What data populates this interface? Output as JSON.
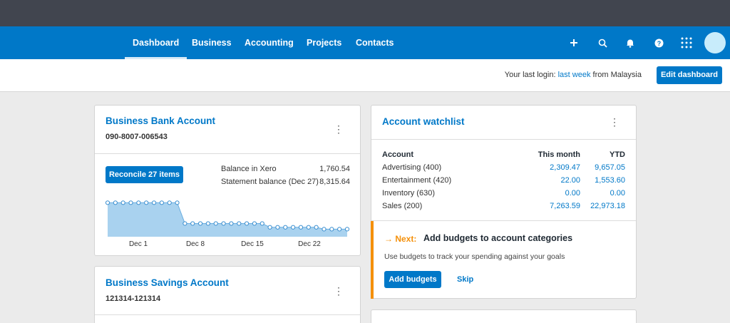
{
  "nav": {
    "items": [
      {
        "label": "Dashboard",
        "active": true
      },
      {
        "label": "Business",
        "active": false
      },
      {
        "label": "Accounting",
        "active": false
      },
      {
        "label": "Projects",
        "active": false
      },
      {
        "label": "Contacts",
        "active": false
      }
    ],
    "icons": [
      "plus-icon",
      "search-icon",
      "bell-icon",
      "help-icon",
      "apps-grid-icon"
    ]
  },
  "subbar": {
    "last_login_prefix": "Your last login:",
    "last_login_link": "last week",
    "last_login_suffix": "from Malaysia",
    "edit_dashboard": "Edit dashboard"
  },
  "bank": {
    "title": "Business Bank Account",
    "account_number": "090-8007-006543",
    "reconcile_label": "Reconcile 27 items",
    "balance_xero_label": "Balance in Xero",
    "balance_xero_value": "1,760.54",
    "statement_label": "Statement balance (Dec 27)",
    "statement_value": "8,315.64"
  },
  "savings": {
    "title": "Business Savings Account",
    "account_number": "121314-121314"
  },
  "watchlist": {
    "title": "Account watchlist",
    "headers": {
      "account": "Account",
      "month": "This month",
      "ytd": "YTD"
    },
    "rows": [
      {
        "account": "Advertising (400)",
        "month": "2,309.47",
        "ytd": "9,657.05"
      },
      {
        "account": "Entertainment (420)",
        "month": "22.00",
        "ytd": "1,553.60"
      },
      {
        "account": "Inventory (630)",
        "month": "0.00",
        "ytd": "0.00"
      },
      {
        "account": "Sales (200)",
        "month": "7,263.59",
        "ytd": "22,973.18"
      }
    ]
  },
  "next": {
    "prefix": "→ Next:",
    "title": "Add budgets to account categories",
    "description": "Use budgets to track your spending against your goals",
    "add_label": "Add budgets",
    "skip_label": "Skip"
  },
  "colors": {
    "brand": "#0078c8",
    "accent_orange": "#f5900a",
    "chart_fill": "#a9d2ef"
  },
  "chart_data": {
    "type": "area",
    "x_tick_labels": [
      "Dec 1",
      "Dec 8",
      "Dec 15",
      "Dec 22"
    ],
    "values": [
      3.6,
      3.6,
      3.6,
      3.6,
      3.6,
      3.6,
      3.6,
      3.6,
      3.6,
      3.6,
      1.4,
      1.4,
      1.4,
      1.4,
      1.4,
      1.4,
      1.4,
      1.4,
      1.4,
      1.4,
      1.4,
      1.0,
      1.0,
      1.0,
      1.0,
      1.0,
      1.0,
      1.0,
      0.8,
      0.8,
      0.8,
      0.8
    ],
    "grid": false
  }
}
